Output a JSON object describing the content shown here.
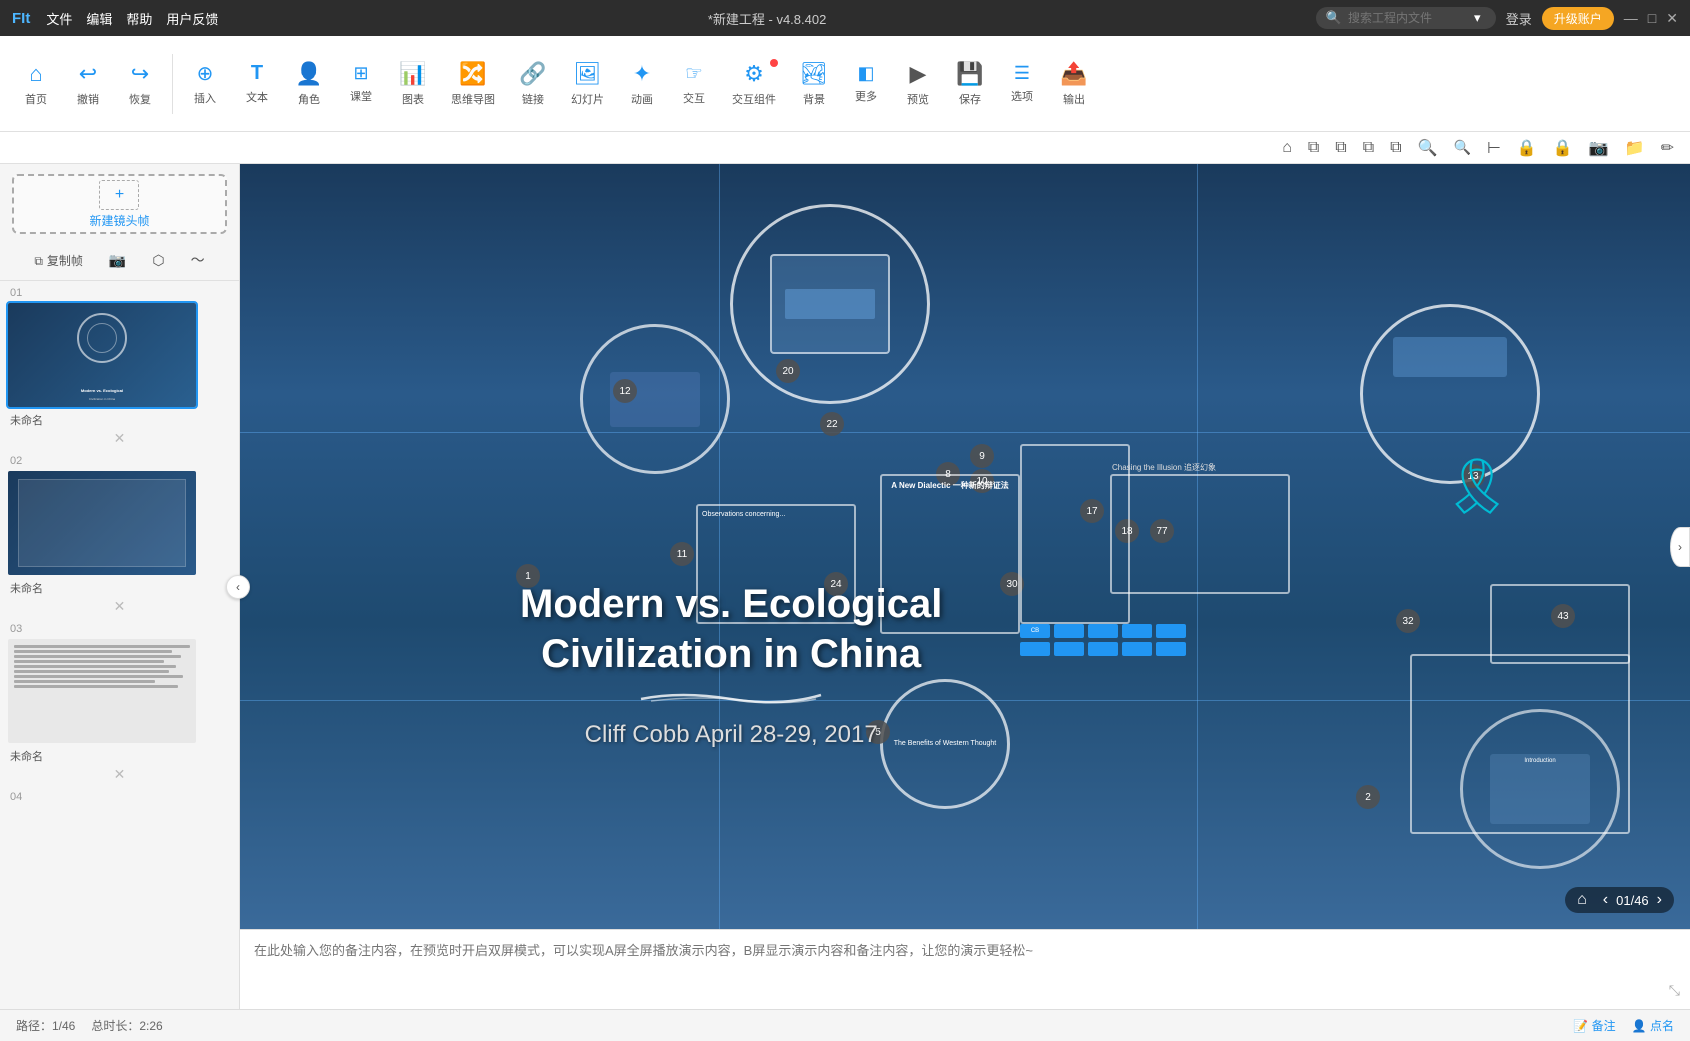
{
  "app": {
    "logo": "FIt",
    "title": "*新建工程 - v4.8.402",
    "menu": [
      "文件",
      "编辑",
      "帮助",
      "用户反馈"
    ],
    "search_placeholder": "搜索工程内文件",
    "login_label": "登录",
    "upgrade_label": "升级账户",
    "win_minimize": "—",
    "win_maximize": "□",
    "win_close": "✕"
  },
  "toolbar": {
    "groups": [
      {
        "id": "home",
        "icon": "⌂",
        "label": "首页"
      },
      {
        "id": "undo",
        "icon": "↩",
        "label": "撤销"
      },
      {
        "id": "redo",
        "icon": "↪",
        "label": "恢复"
      },
      {
        "id": "insert",
        "icon": "⊕",
        "label": "插入"
      },
      {
        "id": "text",
        "icon": "T",
        "label": "文本"
      },
      {
        "id": "role",
        "icon": "👤",
        "label": "角色"
      },
      {
        "id": "classroom",
        "icon": "⊞",
        "label": "课堂"
      },
      {
        "id": "chart",
        "icon": "📊",
        "label": "图表"
      },
      {
        "id": "mindmap",
        "icon": "🔀",
        "label": "思维导图"
      },
      {
        "id": "link",
        "icon": "🔗",
        "label": "链接"
      },
      {
        "id": "slide",
        "icon": "🖼",
        "label": "幻灯片"
      },
      {
        "id": "animation",
        "icon": "✦",
        "label": "动画"
      },
      {
        "id": "interact",
        "icon": "☞",
        "label": "交互"
      },
      {
        "id": "interact-widget",
        "icon": "⚙",
        "label": "交互组件"
      },
      {
        "id": "background",
        "icon": "🏞",
        "label": "背景"
      },
      {
        "id": "shadow",
        "icon": "◧",
        "label": "更多"
      },
      {
        "id": "preview",
        "icon": "▶",
        "label": "预览"
      },
      {
        "id": "save",
        "icon": "💾",
        "label": "保存"
      },
      {
        "id": "options",
        "icon": "☰",
        "label": "选项"
      },
      {
        "id": "export",
        "icon": "📤",
        "label": "输出"
      }
    ]
  },
  "secondary_toolbar": {
    "icons": [
      "⌂",
      "⧉",
      "⧉",
      "⧉",
      "⧉",
      "🔍+",
      "🔍-",
      "⊢",
      "🔒",
      "🔒",
      "📷",
      "📁",
      "✏"
    ]
  },
  "left_panel": {
    "new_frame_label": "新建镜头帧",
    "frame_tools": [
      "复制帧",
      "📷",
      "⬡",
      "〜"
    ],
    "slides": [
      {
        "number": "01",
        "label": "未命名",
        "active": true,
        "type": "presentation"
      },
      {
        "number": "02",
        "label": "未命名",
        "active": false,
        "type": "dark"
      },
      {
        "number": "03",
        "label": "未命名",
        "active": false,
        "type": "text"
      },
      {
        "number": "04",
        "label": "",
        "active": false,
        "type": "placeholder"
      }
    ]
  },
  "canvas": {
    "slide_title_line1": "Modern vs. Ecological",
    "slide_title_line2": "Civilization in China",
    "slide_subtitle": "Cliff Cobb   April 28-29, 2017",
    "nav_current": "01/46",
    "elements": {
      "number_badges": [
        "20",
        "22",
        "12",
        "8",
        "9",
        "10",
        "11",
        "24",
        "30",
        "1",
        "17",
        "18",
        "77",
        "13",
        "2",
        "5",
        "32",
        "43"
      ],
      "circles": true
    }
  },
  "notes": {
    "placeholder": "在此处输入您的备注内容，在预览时开启双屏模式，可以实现A屏全屏播放演示内容，B屏显示演示内容和备注内容，让您的演示更轻松~"
  },
  "status_bar": {
    "path_label": "路径：1/46",
    "duration_label": "总时长：2:26",
    "notes_btn": "备注",
    "pointer_btn": "点名"
  }
}
